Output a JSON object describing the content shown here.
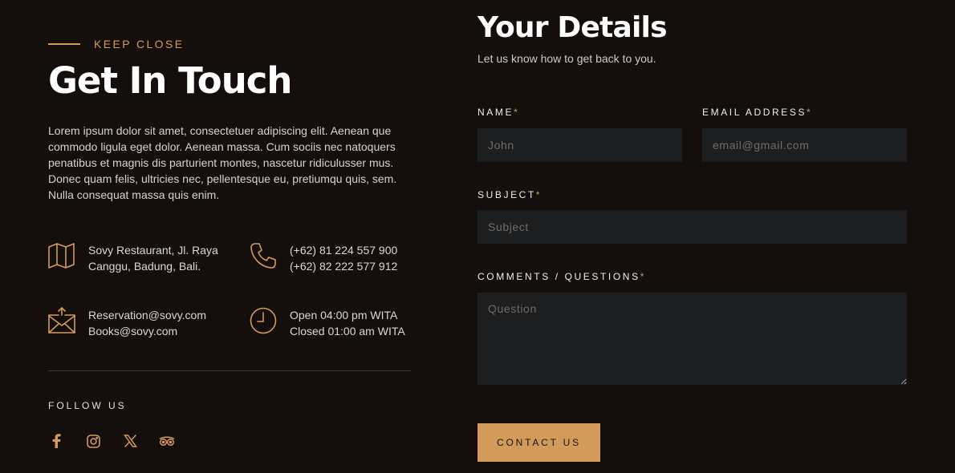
{
  "contact": {
    "eyebrow": "KEEP CLOSE",
    "title": "Get In Touch",
    "intro": "Lorem ipsum dolor sit amet, consectetuer adipiscing elit. Aenean que commodo ligula eget dolor. Aenean massa. Cum sociis nec natoquers penatibus et magnis dis parturient montes, nascetur ridiculusser mus. Donec quam felis, ultricies nec, pellentesque eu, pretiumqu quis, sem. Nulla consequat massa quis enim.",
    "items": [
      {
        "icon": "map-icon",
        "line1": "Sovy Restaurant, Jl. Raya",
        "line2": "Canggu, Badung, Bali."
      },
      {
        "icon": "phone-icon",
        "line1": "(+62) 81 224 557 900",
        "line2": "(+62) 82 222 577 912"
      },
      {
        "icon": "envelope-icon",
        "line1": "Reservation@sovy.com",
        "line2": "Books@sovy.com"
      },
      {
        "icon": "clock-icon",
        "line1": "Open 04:00 pm WITA",
        "line2": "Closed 01:00 am WITA"
      }
    ],
    "follow_label": "FOLLOW US",
    "socials": [
      "facebook-icon",
      "instagram-icon",
      "x-icon",
      "tripadvisor-icon"
    ]
  },
  "form": {
    "title": "Your Details",
    "subtitle": "Let us know how to get back to you.",
    "name": {
      "label": "NAME",
      "required_mark": "*",
      "placeholder": "John",
      "value": ""
    },
    "email": {
      "label": "EMAIL ADDRESS",
      "required_mark": "*",
      "placeholder": "email@gmail.com",
      "value": ""
    },
    "subject": {
      "label": "SUBJECT",
      "required_mark": "*",
      "placeholder": "Subject",
      "value": ""
    },
    "comments": {
      "label": "COMMENTS / QUESTIONS",
      "required_mark": "*",
      "placeholder": "Question",
      "value": ""
    },
    "submit_label": "CONTACT US"
  },
  "colors": {
    "background": "#140f0d",
    "accent": "#d39b5a",
    "field_background": "#1d1e20",
    "heading": "#ffffff"
  }
}
